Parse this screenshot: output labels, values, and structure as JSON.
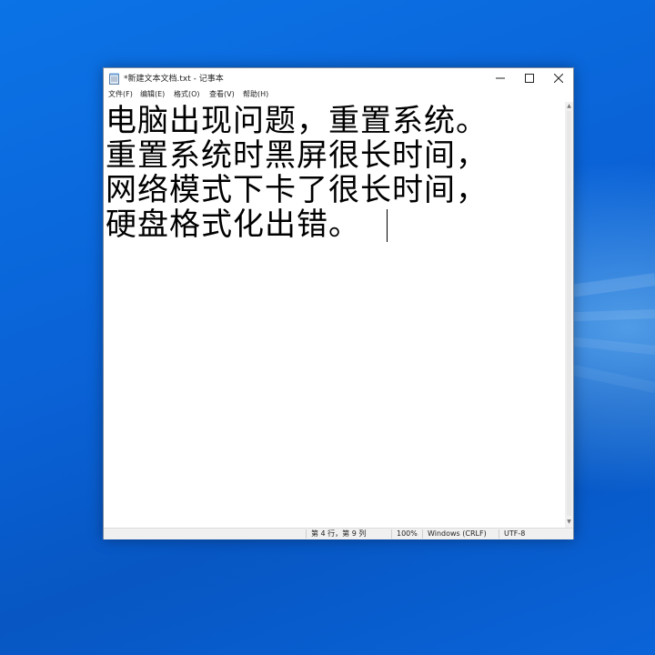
{
  "window": {
    "title": "*新建文本文档.txt - 记事本",
    "controls": {
      "minimize": "—",
      "maximize": "☐",
      "close": "✕"
    }
  },
  "menu": [
    "文件(F)",
    "编辑(E)",
    "格式(O)",
    "查看(V)",
    "帮助(H)"
  ],
  "document": {
    "lines": [
      "电脑出现问题，重置系统。",
      "重置系统时黑屏很长时间，",
      "网络模式下卡了很长时间，",
      "硬盘格式化出错。"
    ]
  },
  "status": {
    "position": "第 4 行，第 9 列",
    "zoom": "100%",
    "line_ending": "Windows (CRLF)",
    "encoding": "UTF-8"
  },
  "icons": [
    "notepad-icon",
    "minimize-icon",
    "maximize-icon",
    "close-icon",
    "scroll-up-icon",
    "scroll-down-icon"
  ]
}
